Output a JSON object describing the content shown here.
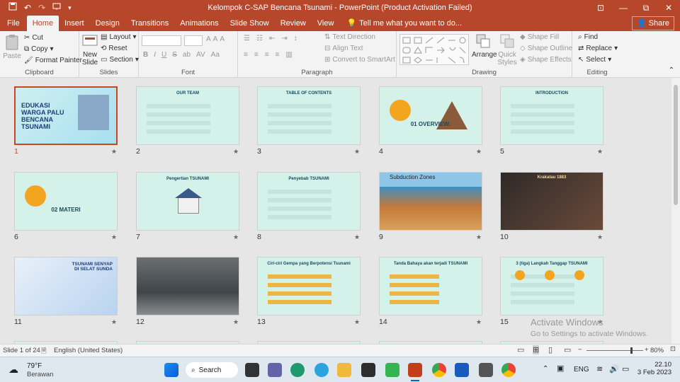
{
  "titlebar": {
    "title": "Kelompok C-SAP Bencana Tsunami  -  PowerPoint (Product Activation Failed)",
    "qa_icons": [
      "save-icon",
      "undo-icon",
      "redo-icon",
      "present-icon",
      "customize-icon"
    ],
    "controls": {
      "minimize": "—",
      "restore": "⧉",
      "close": "✕",
      "ribbon_display": "⊡"
    }
  },
  "tabs": [
    "File",
    "Home",
    "Insert",
    "Design",
    "Transitions",
    "Animations",
    "Slide Show",
    "Review",
    "View"
  ],
  "active_tab": "Home",
  "tellme": "Tell me what you want to do...",
  "share": "Share",
  "ribbon": {
    "clipboard": {
      "paste": "Paste",
      "cut": "Cut",
      "copy": "Copy",
      "format_painter": "Format Painter",
      "label": "Clipboard"
    },
    "slides": {
      "new_slide": "New",
      "new_slide2": "Slide",
      "layout": "Layout",
      "reset": "Reset",
      "section": "Section",
      "label": "Slides"
    },
    "font": {
      "label": "Font",
      "bold": "B",
      "italic": "I",
      "underline": "U",
      "strike": "S",
      "spacing": "ab",
      "shadow": "AV",
      "case": "Aa",
      "clear": "A",
      "grow": "A",
      "shrink": "A"
    },
    "paragraph": {
      "text_direction": "Text Direction",
      "align_text": "Align Text",
      "convert": "Convert to SmartArt",
      "label": "Paragraph"
    },
    "drawing": {
      "arrange": "Arrange",
      "quick_styles": "Quick",
      "quick_styles2": "Styles",
      "shape_fill": "Shape Fill",
      "shape_outline": "Shape Outline",
      "shape_effects": "Shape Effects",
      "label": "Drawing"
    },
    "editing": {
      "find": "Find",
      "replace": "Replace",
      "select": "Select",
      "label": "Editing"
    }
  },
  "slides": [
    {
      "n": "1",
      "title": "EDUKASI WARGA PALU BENCANA TSUNAMI",
      "kind": "cover"
    },
    {
      "n": "2",
      "title": "OUR TEAM",
      "kind": "team"
    },
    {
      "n": "3",
      "title": "TABLE OF CONTENTS",
      "kind": "toc"
    },
    {
      "n": "4",
      "title": "01 OVERVIEW:",
      "kind": "overview"
    },
    {
      "n": "5",
      "title": "INTRODUCTION",
      "kind": "intro"
    },
    {
      "n": "6",
      "title": "02 MATERI",
      "kind": "materi"
    },
    {
      "n": "7",
      "title": "Pengertian TSUNAMI",
      "kind": "house"
    },
    {
      "n": "8",
      "title": "Penyebab TSUNAMI",
      "kind": "text"
    },
    {
      "n": "9",
      "title": "Subduction Zones",
      "kind": "subduction"
    },
    {
      "n": "10",
      "title": "Krakatau 1883",
      "kind": "dark"
    },
    {
      "n": "11",
      "title": "TSUNAMI SENYAP DI SELAT SUNDA",
      "kind": "infographic"
    },
    {
      "n": "12",
      "title": "",
      "kind": "photo"
    },
    {
      "n": "13",
      "title": "Ciri-ciri Gempa yang Berpotensi Tsunami",
      "kind": "list"
    },
    {
      "n": "14",
      "title": "Tanda Bahaya akan terjadi TSUNAMI",
      "kind": "list2"
    },
    {
      "n": "15",
      "title": "3 (tiga) Langkah Tanggap TSUNAMI",
      "kind": "steps"
    }
  ],
  "star": "★",
  "watermark": {
    "line1": "Activate Windows",
    "line2": "Go to Settings to activate Windows."
  },
  "status": {
    "slide_info": "Slide 1 of 24",
    "language": "English (United States)",
    "zoom": "80%",
    "zoom_fraction": 0.8
  },
  "taskbar": {
    "weather_temp": "79°F",
    "weather_desc": "Berawan",
    "search": "Search",
    "lang": "ENG",
    "time": "22.10",
    "date": "3 Feb 2023"
  },
  "colors": {
    "accent": "#b7472a",
    "slide_bg": "#d4f2ea",
    "selected": "#c9471f"
  }
}
